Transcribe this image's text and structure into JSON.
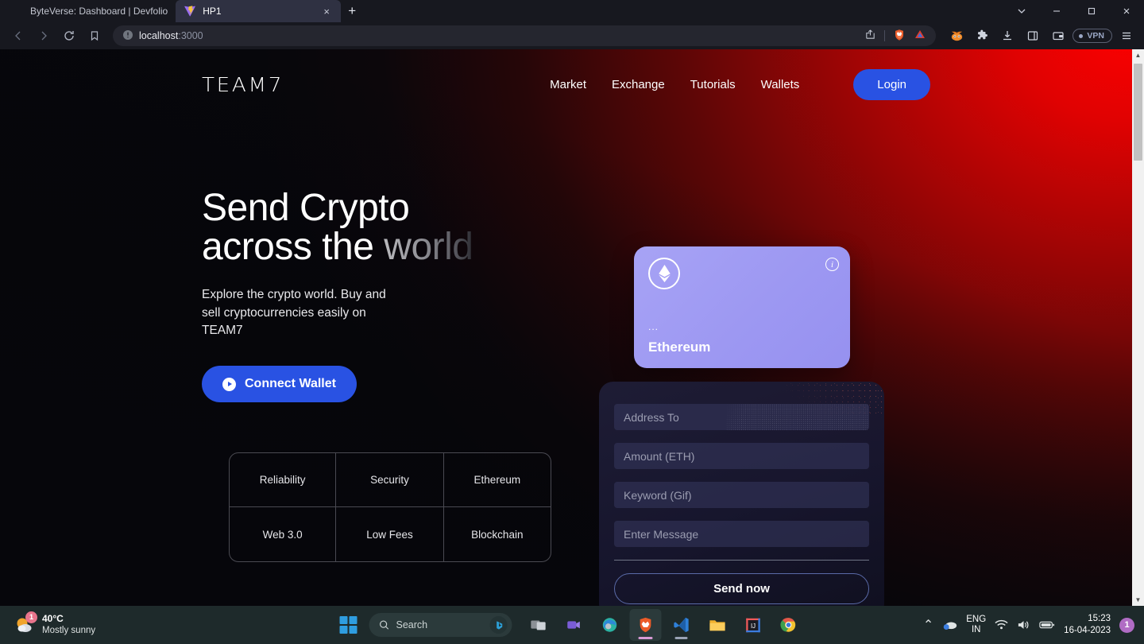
{
  "browser": {
    "tabs": [
      {
        "title": "ByteVerse: Dashboard | Devfolio",
        "icon": "byteverse-favicon",
        "active": false
      },
      {
        "title": "HP1",
        "icon": "vite-favicon",
        "active": true
      }
    ],
    "new_tab_label": "+",
    "close_tab_label": "×",
    "window_controls": {
      "tab_search": "⌄",
      "minimize": "–",
      "maximize": "❑",
      "close": "✕"
    },
    "nav": {
      "back": "back-arrow",
      "forward": "forward-arrow",
      "reload": "reload-icon",
      "bookmark": "bookmark-icon"
    },
    "url": {
      "host": "localhost",
      "port": ":3000",
      "security": "not-secure-icon"
    },
    "url_actions": [
      "share-icon",
      "brave-shield-icon",
      "brave-rewards-icon"
    ],
    "toolbar_icons": [
      "metamask-icon",
      "extensions-icon",
      "downloads-icon",
      "sidebar-icon",
      "wallet-icon"
    ],
    "vpn_label": "VPN"
  },
  "site": {
    "logo": "TEAM7",
    "nav_links": [
      "Market",
      "Exchange",
      "Tutorials",
      "Wallets"
    ],
    "login_label": "Login",
    "hero": {
      "title_line1": "Send Crypto",
      "title_line2_plain": "across the ",
      "title_line2_faded": "world",
      "subtitle": "Explore the crypto world. Buy and sell cryptocurrencies easily on TEAM7",
      "connect_label": "Connect Wallet"
    },
    "features": [
      "Reliability",
      "Security",
      "Ethereum",
      "Web 3.0",
      "Low Fees",
      "Blockchain"
    ],
    "eth_card": {
      "coin_icon": "ethereum-icon",
      "info_icon": "info-icon",
      "dots": "...",
      "name": "Ethereum"
    },
    "form": {
      "fields": [
        {
          "name": "address-to",
          "placeholder": "Address To",
          "value": ""
        },
        {
          "name": "amount",
          "placeholder": "Amount (ETH)",
          "value": ""
        },
        {
          "name": "keyword",
          "placeholder": "Keyword (Gif)",
          "value": ""
        },
        {
          "name": "message",
          "placeholder": "Enter Message",
          "value": ""
        }
      ],
      "submit_label": "Send now"
    },
    "colors": {
      "accent_blue": "#2952e3",
      "card_purple": "#a09bf3",
      "bg_red": "#e00202",
      "bg_dark": "#07070b"
    }
  },
  "taskbar": {
    "weather": {
      "temperature": "40°C",
      "condition": "Mostly sunny",
      "badge": "1"
    },
    "search_placeholder": "Search",
    "apps": [
      "task-view",
      "teams-icon",
      "edge-icon",
      "brave-icon",
      "vscode-icon",
      "file-explorer-icon",
      "intellij-icon",
      "chrome-icon"
    ],
    "tray": {
      "overflow": "⌃",
      "cloud": "onedrive-icon",
      "language_line1": "ENG",
      "language_line2": "IN",
      "wifi": "wifi-icon",
      "volume": "volume-icon",
      "battery": "battery-icon",
      "time": "15:23",
      "date": "16-04-2023",
      "notification_badge": "1"
    }
  }
}
